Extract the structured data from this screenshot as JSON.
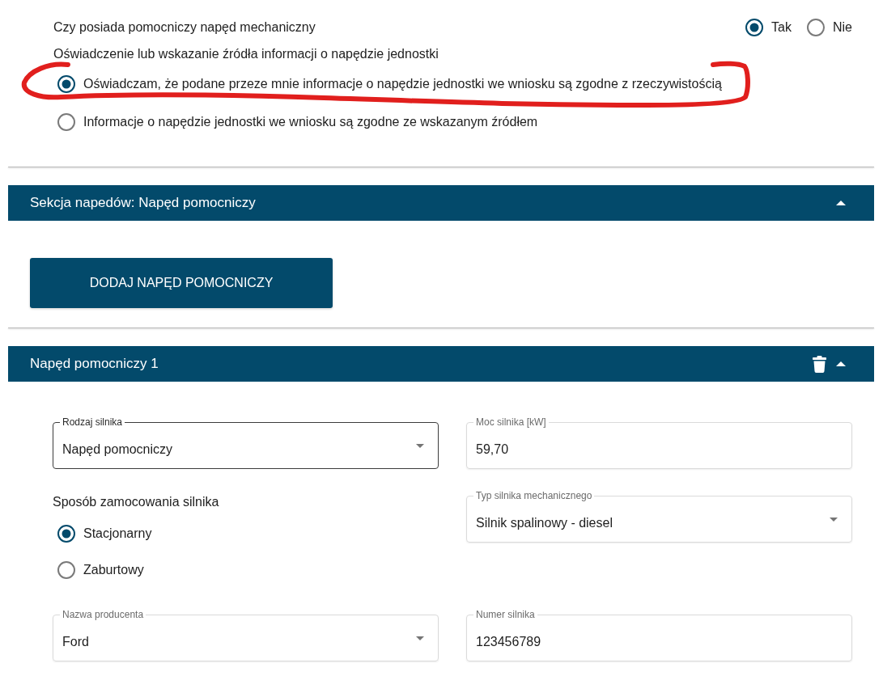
{
  "eligibility": {
    "question": "Czy posiada pomocniczy napęd mechaniczny",
    "options": [
      {
        "label": "Tak",
        "selected": true
      },
      {
        "label": "Nie",
        "selected": false
      }
    ]
  },
  "declaration": {
    "label": "Oświadczenie lub wskazanie źródła informacji o napędzie jednostki",
    "options": [
      {
        "label": "Oświadczam, że podane przeze mnie informacje o napędzie jednostki we wniosku są zgodne z rzeczywistością",
        "selected": true,
        "circled": true
      },
      {
        "label": "Informacje o napędzie jednostki we wniosku są zgodne ze wskazanym źródłem",
        "selected": false,
        "circled": false
      }
    ]
  },
  "drives_section": {
    "title": "Sekcja napedów: Napęd pomocniczy",
    "expanded": true,
    "add_button": "DODAJ NAPĘD POMOCNICZY"
  },
  "drive": {
    "title": "Napęd pomocniczy 1",
    "expanded": true,
    "removable": true,
    "fields": [
      {
        "kind": "select",
        "label": "Rodzaj silnika",
        "value": "Napęd pomocniczy",
        "focused": true
      },
      {
        "kind": "text",
        "label": "Moc silnika [kW]",
        "value": "59,70",
        "focused": false
      },
      {
        "kind": "radio_group",
        "label": "Sposób zamocowania silnika",
        "options": [
          {
            "label": "Stacjonarny",
            "selected": true
          },
          {
            "label": "Zaburtowy",
            "selected": false
          }
        ]
      },
      {
        "kind": "select",
        "label": "Typ silnika mechanicznego",
        "value": "Silnik spalinowy - diesel",
        "focused": false
      },
      {
        "kind": "select",
        "label": "Nazwa producenta",
        "value": "Ford",
        "focused": false
      },
      {
        "kind": "text",
        "label": "Numer silnika",
        "value": "123456789",
        "focused": false
      }
    ]
  }
}
